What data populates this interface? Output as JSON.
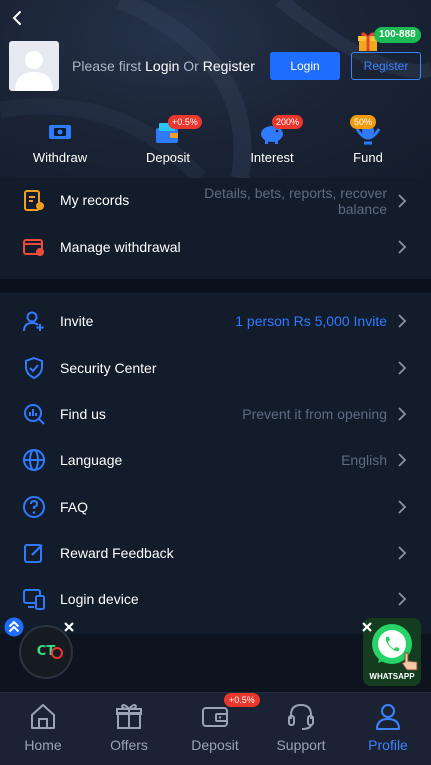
{
  "header": {
    "prompt_prefix": "Please first ",
    "login_word": "Login",
    "or_word": " Or ",
    "register_word": "Register",
    "login_button": "Login",
    "register_button": "Register",
    "gift_badge": "100-888"
  },
  "quick_actions": [
    {
      "label": "Withdraw",
      "badge": ""
    },
    {
      "label": "Deposit",
      "badge": "+0.5%"
    },
    {
      "label": "Interest",
      "badge": "200%"
    },
    {
      "label": "Fund",
      "badge": "50%"
    }
  ],
  "records": [
    {
      "label": "My records",
      "value_line1": "Details, bets, reports, recover",
      "value_line2": "balance"
    },
    {
      "label": "Manage withdrawal",
      "value_line1": "",
      "value_line2": ""
    }
  ],
  "menu": [
    {
      "label": "Invite",
      "value": "1 person Rs 5,000  Invite"
    },
    {
      "label": "Security Center",
      "value": ""
    },
    {
      "label": "Find us",
      "value": "Prevent it from opening"
    },
    {
      "label": "Language",
      "value": "English"
    },
    {
      "label": "FAQ",
      "value": ""
    },
    {
      "label": "Reward Feedback",
      "value": ""
    },
    {
      "label": "Login device",
      "value": ""
    }
  ],
  "floating": {
    "left_logo_text": "CT",
    "whatsapp_text": "WHATSAPP"
  },
  "tabs": [
    {
      "label": "Home",
      "icon": "home-icon"
    },
    {
      "label": "Offers",
      "icon": "gift-icon"
    },
    {
      "label": "Deposit",
      "icon": "wallet-icon",
      "badge": "+0.5%"
    },
    {
      "label": "Support",
      "icon": "headset-icon"
    },
    {
      "label": "Profile",
      "icon": "user-icon",
      "active": true
    }
  ],
  "colors": {
    "accent": "#1f6dff",
    "active_tab": "#3d82ff",
    "badge_red": "#e8372c",
    "badge_orange": "#f29b0c",
    "badge_green": "#1db954",
    "icon_blue": "#2f7bff",
    "icon_orange": "#f0a020",
    "icon_red": "#ef4a3c"
  }
}
